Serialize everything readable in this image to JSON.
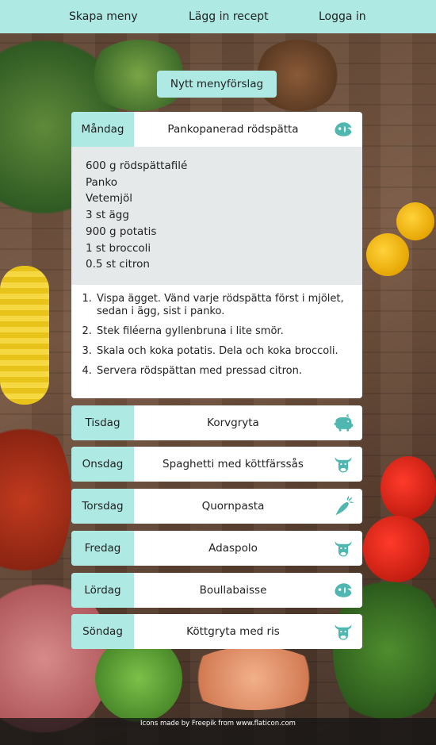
{
  "nav": {
    "items": [
      "Skapa meny",
      "Lägg in recept",
      "Logga in"
    ]
  },
  "new_menu_button": "Nytt menyförslag",
  "colors": {
    "accent": "#aee9e4",
    "icon": "#4fb7b0",
    "ingredients_bg": "#e6e9ea"
  },
  "days": [
    {
      "day": "Måndag",
      "dish": "Pankopanerad rödspätta",
      "icon": "fish-icon",
      "expanded": true,
      "ingredients": [
        "600 g rödspättafilé",
        "Panko",
        "Vetemjöl",
        "3 st ägg",
        "900 g potatis",
        "1 st broccoli",
        "0.5 st citron"
      ],
      "steps": [
        "Vispa ägget. Vänd varje rödspätta först i mjölet, sedan i ägg, sist i panko.",
        "Stek filéerna gyllenbruna i lite smör.",
        "Skala och koka potatis. Dela och koka broccoli.",
        "Servera rödspättan med pressad citron."
      ]
    },
    {
      "day": "Tisdag",
      "dish": "Korvgryta",
      "icon": "pig-icon"
    },
    {
      "day": "Onsdag",
      "dish": "Spaghetti med köttfärssås",
      "icon": "cow-icon"
    },
    {
      "day": "Torsdag",
      "dish": "Quornpasta",
      "icon": "carrot-icon"
    },
    {
      "day": "Fredag",
      "dish": "Adaspolo",
      "icon": "cow-icon"
    },
    {
      "day": "Lördag",
      "dish": "Boullabaisse",
      "icon": "fish-icon"
    },
    {
      "day": "Söndag",
      "dish": "Köttgryta med ris",
      "icon": "cow-icon"
    }
  ],
  "footer_credit": "Icons made by Freepik from www.flaticon.com"
}
